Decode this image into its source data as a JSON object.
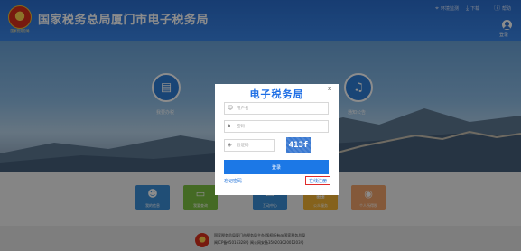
{
  "header": {
    "title": "国家税务总局厦门市电子税务局",
    "emblem_caption": "国家税务总局",
    "links": [
      {
        "label": "环境监测",
        "icon": "monitor-icon"
      },
      {
        "label": "下载",
        "icon": "download-icon"
      },
      {
        "label": "帮助",
        "icon": "help-icon"
      }
    ],
    "login_label": "登录"
  },
  "banner": {
    "services": [
      {
        "label": "我要办税",
        "icon": "tax-document-icon"
      },
      {
        "label": "通知公告",
        "icon": "bell-icon"
      }
    ]
  },
  "tiles": [
    {
      "label": "我的信息",
      "icon": "user-icon",
      "color": "#3b8fd8"
    },
    {
      "label": "我要查询",
      "icon": "monitor-icon",
      "color": "#7dc243"
    },
    {
      "label": "互动中心",
      "icon": "chat-icon",
      "color": "#3b8fd8"
    },
    {
      "label": "公众服务",
      "icon": "grid-icon",
      "color": "#f2b233"
    },
    {
      "label": "个人所得税",
      "icon": "coin-icon",
      "color": "#f0a36a"
    }
  ],
  "footer": {
    "line1": "国家税务总局厦门市税务局主办 版权所有@国家税务总局",
    "line2": "闽ICP备05016328号 闽公网安备35020302001203号"
  },
  "modal": {
    "title": "电子税务局",
    "close": "x",
    "username_placeholder": "用户名",
    "password_placeholder": "密码",
    "captcha_placeholder": "验证码",
    "captcha_text": "413f",
    "login_button": "登录",
    "forgot_password": "忘记密码",
    "register": "在线注册"
  },
  "colors": {
    "brand_blue": "#1c78e6",
    "header_blue": "#2b6fd0",
    "register_highlight": "#e02b2b"
  }
}
